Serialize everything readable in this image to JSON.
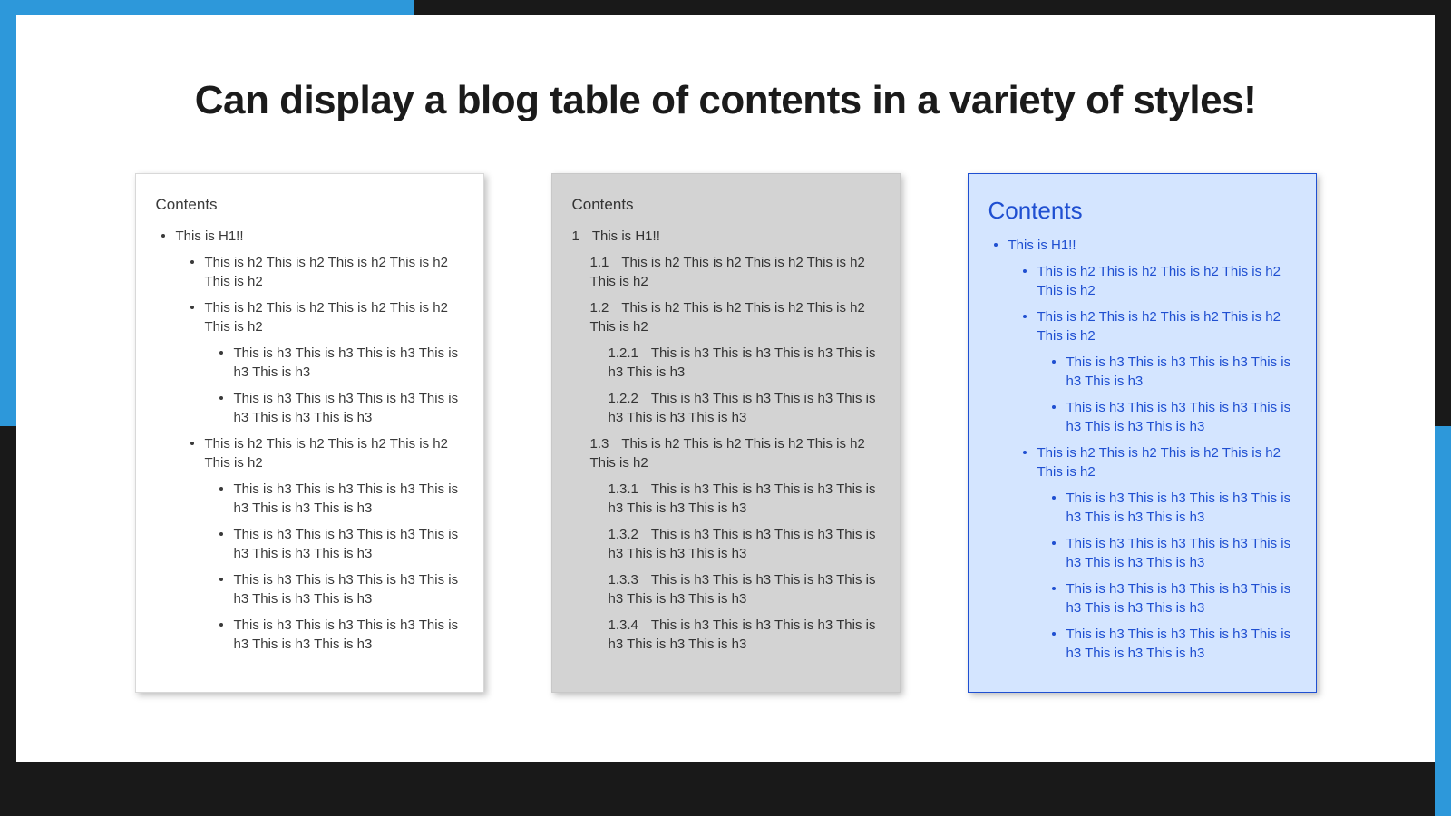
{
  "title": "Can display a blog table of contents in a variety of styles!",
  "card_titles": {
    "a": "Contents",
    "b": "Contents",
    "c": "Contents"
  },
  "bullet_toc": [
    {
      "text": "This is H1!!",
      "children": [
        {
          "text": "This is h2 This is h2 This is h2 This is h2 This is h2",
          "children": []
        },
        {
          "text": "This is h2 This is h2 This is h2 This is h2 This is h2",
          "children": [
            {
              "text": "This is h3 This is h3 This is h3 This is h3 This is h3",
              "children": []
            },
            {
              "text": "This is h3 This is h3 This is h3 This is h3 This is h3 This is h3",
              "children": []
            }
          ]
        },
        {
          "text": "This is h2 This is h2 This is h2 This is h2 This is h2",
          "children": [
            {
              "text": "This is h3 This is h3 This is h3 This is h3 This is h3 This is h3",
              "children": []
            },
            {
              "text": "This is h3 This is h3 This is h3 This is h3 This is h3 This is h3",
              "children": []
            },
            {
              "text": "This is h3 This is h3 This is h3 This is h3 This is h3 This is h3",
              "children": []
            },
            {
              "text": "This is h3 This is h3 This is h3 This is h3 This is h3 This is h3",
              "children": []
            }
          ]
        }
      ]
    }
  ],
  "numbered_toc": [
    {
      "num": "1",
      "indent": 1,
      "text": "This is H1!!"
    },
    {
      "num": "1.1",
      "indent": 2,
      "text": "This is h2 This is h2 This is h2 This is h2 This is h2"
    },
    {
      "num": "1.2",
      "indent": 2,
      "text": "This is h2 This is h2 This is h2 This is h2 This is h2"
    },
    {
      "num": "1.2.1",
      "indent": 3,
      "text": "This is h3 This is h3 This is h3 This is h3 This is h3"
    },
    {
      "num": "1.2.2",
      "indent": 3,
      "text": "This is h3 This is h3 This is h3 This is h3 This is h3 This is h3"
    },
    {
      "num": "1.3",
      "indent": 2,
      "text": "This is h2 This is h2 This is h2 This is h2 This is h2"
    },
    {
      "num": "1.3.1",
      "indent": 3,
      "text": "This is h3 This is h3 This is h3 This is h3 This is h3 This is h3"
    },
    {
      "num": "1.3.2",
      "indent": 3,
      "text": "This is h3 This is h3 This is h3 This is h3 This is h3 This is h3"
    },
    {
      "num": "1.3.3",
      "indent": 3,
      "text": "This is h3 This is h3 This is h3 This is h3 This is h3 This is h3"
    },
    {
      "num": "1.3.4",
      "indent": 3,
      "text": "This is h3 This is h3 This is h3 This is h3 This is h3 This is h3"
    }
  ]
}
